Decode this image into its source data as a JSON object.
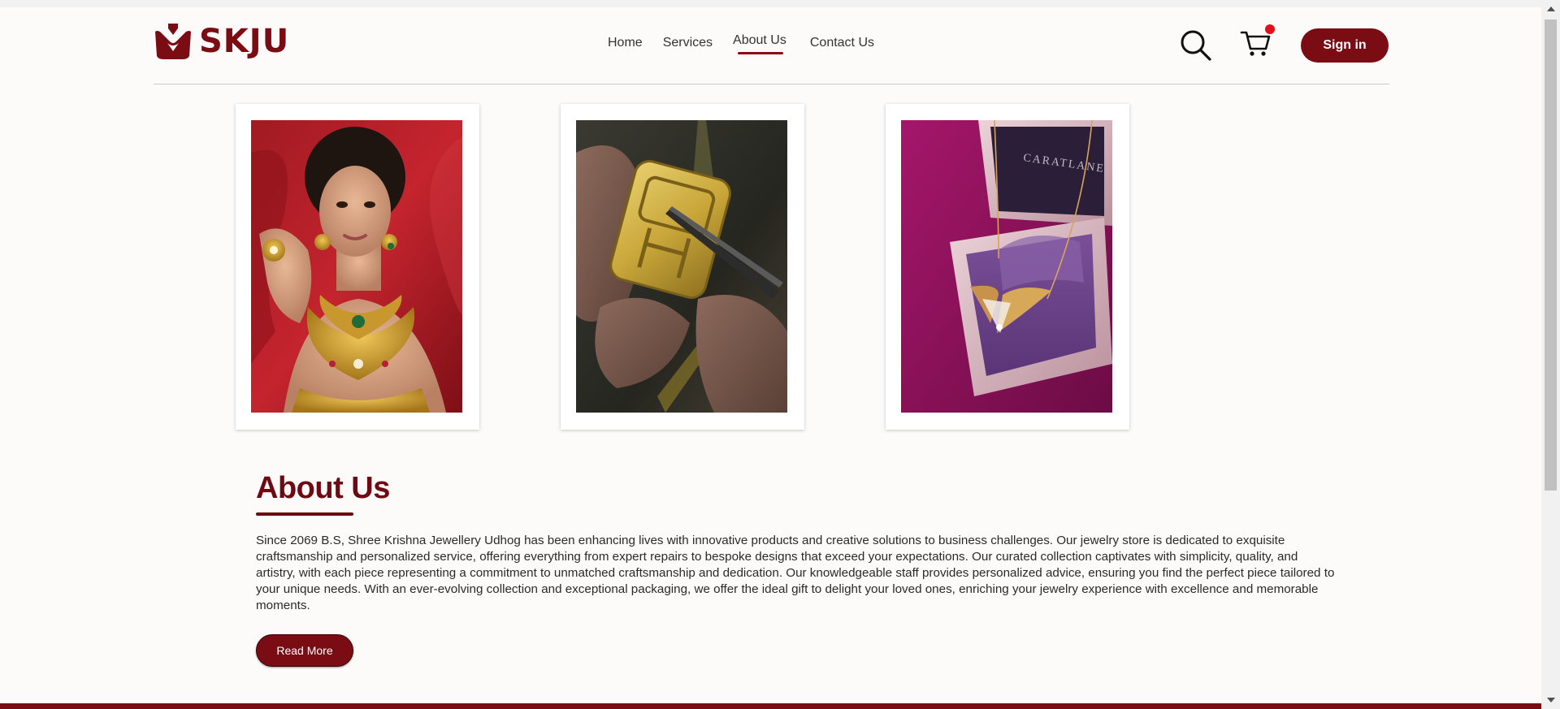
{
  "brand": {
    "name": "SKJU",
    "color": "#7a0c14"
  },
  "nav": {
    "items": [
      {
        "label": "Home",
        "active": false
      },
      {
        "label": "Services",
        "active": false
      },
      {
        "label": "About Us",
        "active": true
      },
      {
        "label": "Contact Us",
        "active": false
      }
    ]
  },
  "header": {
    "search_icon": "search-icon",
    "cart_icon": "cart-icon",
    "cart_has_notification": true,
    "signin_label": "Sign in"
  },
  "gallery": [
    {
      "name": "model-with-gold-jewellery",
      "icon": "photo"
    },
    {
      "name": "artisan-crafting-gold-pendant",
      "icon": "photo"
    },
    {
      "name": "necklace-in-gift-box",
      "icon": "photo",
      "box_text": "CARATLANE"
    }
  ],
  "about": {
    "title": "About Us",
    "text": "Since 2069 B.S, Shree Krishna Jewellery Udhog has been enhancing lives with innovative products and creative solutions to business challenges. Our jewelry store is dedicated to exquisite craftsmanship and personalized service, offering everything from expert repairs to bespoke designs that exceed your expectations. Our curated collection captivates with simplicity, quality, and artistry, with each piece representing a commitment to unmatched craftsmanship and dedication. Our knowledgeable staff provides personalized advice, ensuring you find the perfect piece tailored to your unique needs. With an ever-evolving collection and exceptional packaging, we offer the ideal gift to delight your loved ones, enriching your jewelry experience with excellence and memorable moments.",
    "button_label": "Read More"
  },
  "colors": {
    "accent": "#7a0c14",
    "notification": "#e0101a",
    "background": "#fdfafa"
  }
}
